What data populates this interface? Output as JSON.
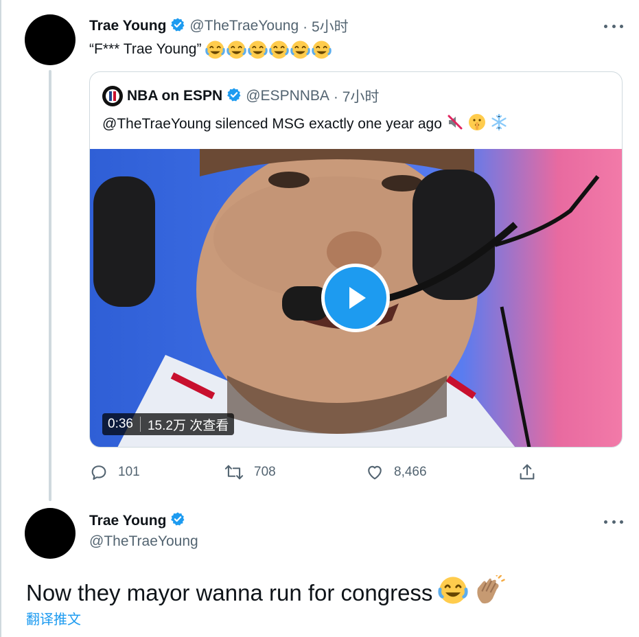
{
  "tweet1": {
    "author": "Trae Young",
    "handle": "@TheTraeYoung",
    "time": "· 5小时",
    "text": "“F*** Trae Young”",
    "emoji": [
      "face-with-tears-of-joy",
      "face-with-tears-of-joy",
      "face-with-tears-of-joy",
      "face-with-tears-of-joy",
      "face-with-tears-of-joy",
      "face-with-tears-of-joy"
    ],
    "stats": {
      "replies": "101",
      "retweets": "708",
      "likes": "8,466"
    }
  },
  "quote": {
    "author": "NBA on ESPN",
    "handle": "@ESPNNBA",
    "time": "· 7小时",
    "text": "@TheTraeYoung silenced MSG exactly one year ago",
    "emoji": [
      "muted-speaker",
      "shushing-face",
      "snowflake"
    ],
    "video": {
      "duration": "0:36",
      "views": "15.2万 次查看"
    }
  },
  "tweet2": {
    "author": "Trae Young",
    "handle": "@TheTraeYoung",
    "text": "Now they mayor wanna run for congress",
    "emoji": [
      "face-with-tears-of-joy",
      "clapping-hands"
    ],
    "translate_label": "翻译推文"
  },
  "colors": {
    "accent": "#1d9bf0",
    "muted": "#536471",
    "border": "#cfd9de"
  }
}
